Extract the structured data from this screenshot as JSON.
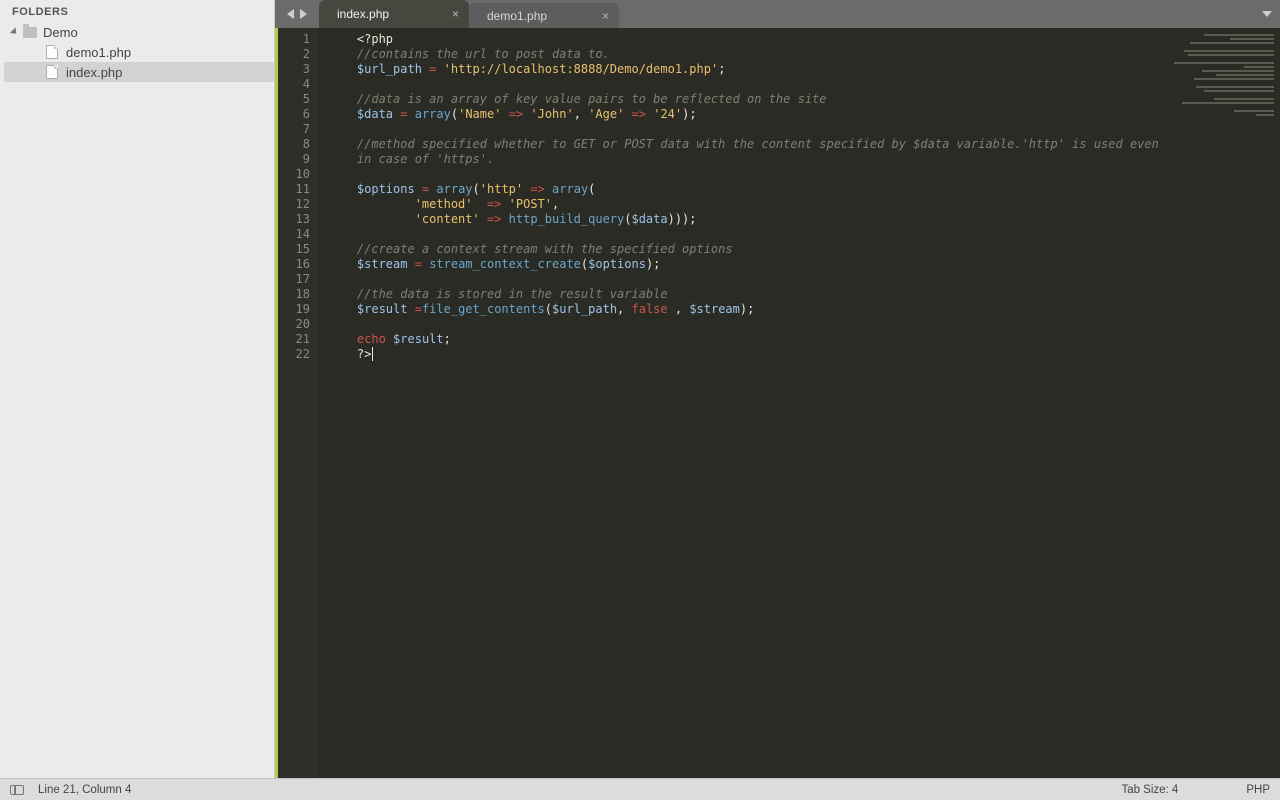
{
  "sidebar": {
    "header": "FOLDERS",
    "folder": {
      "name": "Demo"
    },
    "files": [
      {
        "name": "demo1.php",
        "selected": false
      },
      {
        "name": "index.php",
        "selected": true
      }
    ]
  },
  "tabs": [
    {
      "label": "index.php",
      "active": true
    },
    {
      "label": "demo1.php",
      "active": false
    }
  ],
  "code": {
    "lines": [
      [
        {
          "t": "tag",
          "v": "<?php"
        }
      ],
      [
        {
          "t": "com",
          "v": "//contains the url to post data to."
        }
      ],
      [
        {
          "t": "var",
          "v": "$url_path"
        },
        {
          "t": "pun",
          "v": " "
        },
        {
          "t": "op",
          "v": "="
        },
        {
          "t": "pun",
          "v": " "
        },
        {
          "t": "str",
          "v": "'http://localhost:8888/Demo/demo1.php'"
        },
        {
          "t": "pun",
          "v": ";"
        }
      ],
      [],
      [
        {
          "t": "com",
          "v": "//data is an array of key value pairs to be reflected on the site"
        }
      ],
      [
        {
          "t": "var",
          "v": "$data"
        },
        {
          "t": "pun",
          "v": " "
        },
        {
          "t": "op",
          "v": "="
        },
        {
          "t": "pun",
          "v": " "
        },
        {
          "t": "fn",
          "v": "array"
        },
        {
          "t": "pun",
          "v": "("
        },
        {
          "t": "str",
          "v": "'Name'"
        },
        {
          "t": "pun",
          "v": " "
        },
        {
          "t": "op",
          "v": "=>"
        },
        {
          "t": "pun",
          "v": " "
        },
        {
          "t": "str",
          "v": "'John'"
        },
        {
          "t": "pun",
          "v": ", "
        },
        {
          "t": "str",
          "v": "'Age'"
        },
        {
          "t": "pun",
          "v": " "
        },
        {
          "t": "op",
          "v": "=>"
        },
        {
          "t": "pun",
          "v": " "
        },
        {
          "t": "str",
          "v": "'24'"
        },
        {
          "t": "pun",
          "v": ");"
        }
      ],
      [],
      [
        {
          "t": "com",
          "v": "//method specified whether to GET or POST data with the content specified by $data variable.'http' is used even in case of 'https'."
        }
      ],
      [],
      [
        {
          "t": "var",
          "v": "$options"
        },
        {
          "t": "pun",
          "v": " "
        },
        {
          "t": "op",
          "v": "="
        },
        {
          "t": "pun",
          "v": " "
        },
        {
          "t": "fn",
          "v": "array"
        },
        {
          "t": "pun",
          "v": "("
        },
        {
          "t": "str",
          "v": "'http'"
        },
        {
          "t": "pun",
          "v": " "
        },
        {
          "t": "op",
          "v": "=>"
        },
        {
          "t": "pun",
          "v": " "
        },
        {
          "t": "fn",
          "v": "array"
        },
        {
          "t": "pun",
          "v": "("
        }
      ],
      [
        {
          "t": "pun",
          "v": "        "
        },
        {
          "t": "str",
          "v": "'method'"
        },
        {
          "t": "pun",
          "v": "  "
        },
        {
          "t": "op",
          "v": "=>"
        },
        {
          "t": "pun",
          "v": " "
        },
        {
          "t": "str",
          "v": "'POST'"
        },
        {
          "t": "pun",
          "v": ","
        }
      ],
      [
        {
          "t": "pun",
          "v": "        "
        },
        {
          "t": "str",
          "v": "'content'"
        },
        {
          "t": "pun",
          "v": " "
        },
        {
          "t": "op",
          "v": "=>"
        },
        {
          "t": "pun",
          "v": " "
        },
        {
          "t": "fn",
          "v": "http_build_query"
        },
        {
          "t": "pun",
          "v": "("
        },
        {
          "t": "var",
          "v": "$data"
        },
        {
          "t": "pun",
          "v": ")));"
        }
      ],
      [],
      [
        {
          "t": "com",
          "v": "//create a context stream with the specified options"
        }
      ],
      [
        {
          "t": "var",
          "v": "$stream"
        },
        {
          "t": "pun",
          "v": " "
        },
        {
          "t": "op",
          "v": "="
        },
        {
          "t": "pun",
          "v": " "
        },
        {
          "t": "fn",
          "v": "stream_context_create"
        },
        {
          "t": "pun",
          "v": "("
        },
        {
          "t": "var",
          "v": "$options"
        },
        {
          "t": "pun",
          "v": ");"
        }
      ],
      [],
      [
        {
          "t": "com",
          "v": "//the data is stored in the result variable"
        }
      ],
      [
        {
          "t": "var",
          "v": "$result"
        },
        {
          "t": "pun",
          "v": " "
        },
        {
          "t": "op",
          "v": "="
        },
        {
          "t": "fn",
          "v": "file_get_contents"
        },
        {
          "t": "pun",
          "v": "("
        },
        {
          "t": "var",
          "v": "$url_path"
        },
        {
          "t": "pun",
          "v": ", "
        },
        {
          "t": "kw",
          "v": "false"
        },
        {
          "t": "pun",
          "v": " , "
        },
        {
          "t": "var",
          "v": "$stream"
        },
        {
          "t": "pun",
          "v": ");"
        }
      ],
      [],
      [
        {
          "t": "kw",
          "v": "echo"
        },
        {
          "t": "pun",
          "v": " "
        },
        {
          "t": "var",
          "v": "$result"
        },
        {
          "t": "pun",
          "v": ";"
        }
      ],
      [
        {
          "t": "tag",
          "v": "?>"
        }
      ]
    ],
    "wrap_at": 112,
    "indent": "    "
  },
  "minimap_widths": [
    70,
    44,
    84,
    0,
    90,
    86,
    0,
    100,
    30,
    72,
    58,
    80,
    0,
    78,
    70,
    0,
    60,
    92,
    0,
    40,
    18
  ],
  "status": {
    "position": "Line 21, Column 4",
    "tab_size": "Tab Size: 4",
    "language": "PHP"
  },
  "colors": {
    "accent": "#b9ca4a",
    "editor_bg": "#2b2b26",
    "tabbar_bg": "#6b6b6b"
  }
}
